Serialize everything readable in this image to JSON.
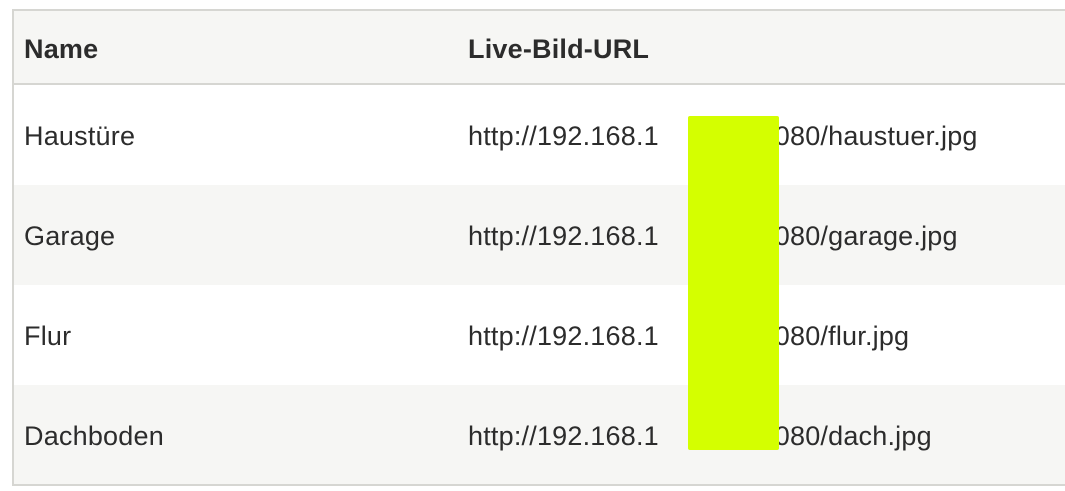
{
  "table": {
    "columns": [
      "Name",
      "Live-Bild-URL"
    ],
    "rows": [
      {
        "name": "Haustüre",
        "url_prefix": "http://192.168.1",
        "url_suffix": ":8080/haustuer.jpg"
      },
      {
        "name": "Garage",
        "url_prefix": "http://192.168.1",
        "url_suffix": ":8080/garage.jpg"
      },
      {
        "name": "Flur",
        "url_prefix": "http://192.168.1",
        "url_suffix": ":8080/flur.jpg"
      },
      {
        "name": "Dachboden",
        "url_prefix": "http://192.168.1",
        "url_suffix": ":8080/dach.jpg"
      }
    ]
  },
  "colors": {
    "border": "#d6d6d2",
    "stripe": "#f6f6f4",
    "text": "#2c2c2c",
    "redaction": "#d4ff00"
  }
}
